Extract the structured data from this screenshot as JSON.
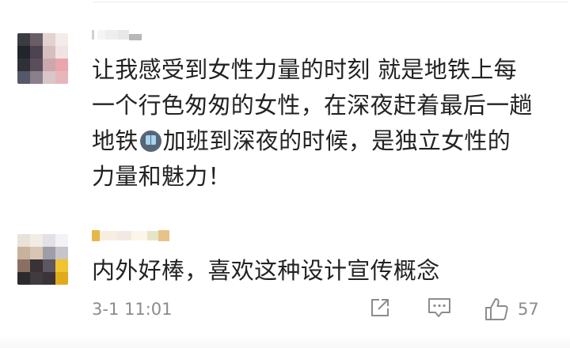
{
  "comments": [
    {
      "lines": [
        "让我感受到女性力量的时刻 就是地铁上每",
        "一个行色匆匆的女性，在深夜赶着最后一趟",
        [
          "地铁",
          "加班到深夜的时候，是独立女性的"
        ],
        "力量和魅力！"
      ],
      "inline_icon": "metro-emoji-icon"
    },
    {
      "lines": [
        "内外好棒，喜欢这种设计宣传概念"
      ],
      "timestamp": "3-1 11:01",
      "like_count": "57"
    }
  ],
  "icons": {
    "share": "share-icon",
    "comment": "comment-icon",
    "like": "thumbs-up-icon"
  },
  "colors": {
    "text": "#222222",
    "meta": "#8c8c8c"
  }
}
